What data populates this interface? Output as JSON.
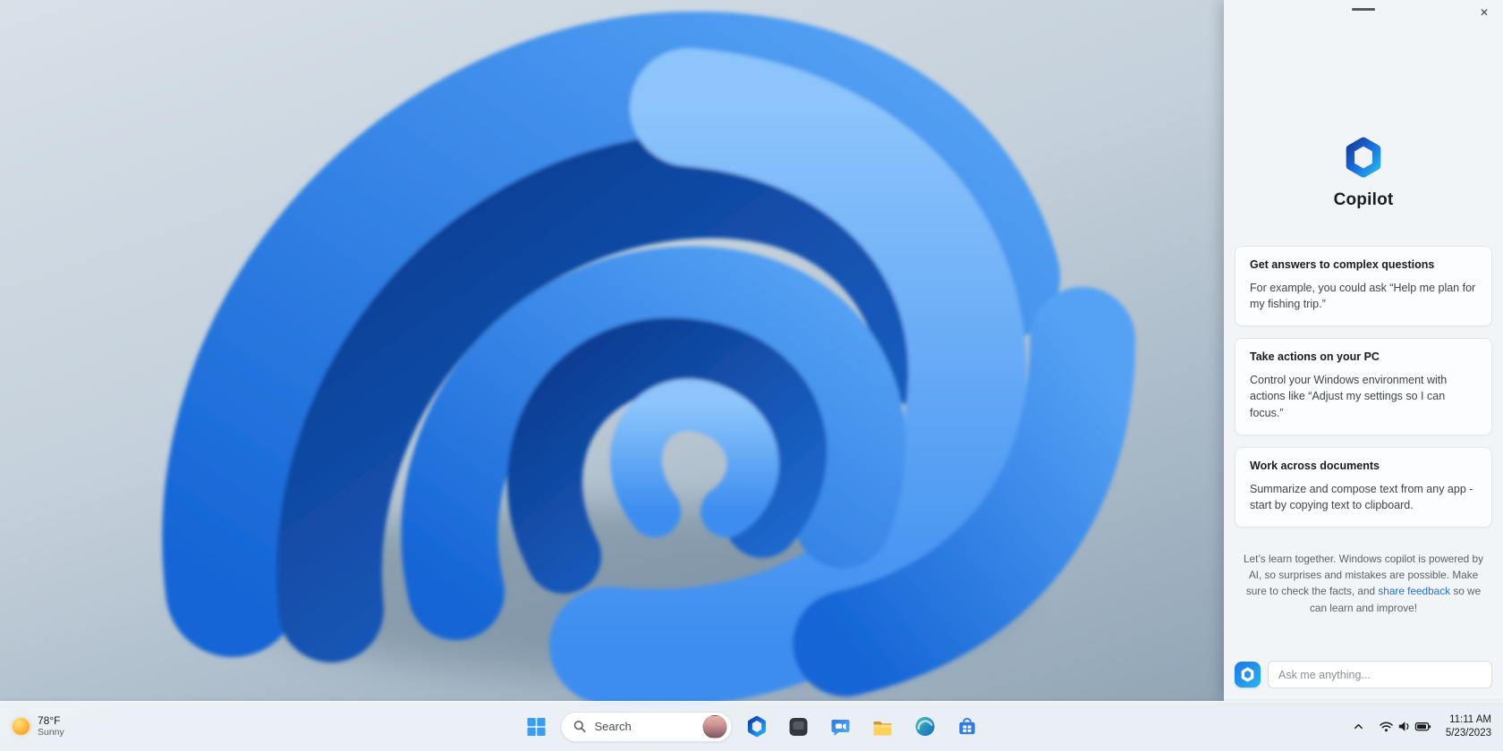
{
  "copilot_panel": {
    "title": "Copilot",
    "window_controls": {
      "close_glyph": "✕"
    },
    "cards": [
      {
        "title": "Get answers to complex questions",
        "body": "For example, you could ask “Help me plan for my fishing trip.”"
      },
      {
        "title": "Take actions on your PC",
        "body": "Control your Windows environment with actions like “Adjust my settings so I can focus.”"
      },
      {
        "title": "Work across documents",
        "body": "Summarize and compose text from any app - start by copying text to clipboard."
      }
    ],
    "disclaimer": {
      "pre": "Let’s learn together. Windows copilot is powered by AI, so surprises and mistakes are possible. Make sure to check the facts, and ",
      "link": "share feedback",
      "post": " so we can learn and improve!"
    },
    "input_placeholder": "Ask me anything..."
  },
  "taskbar": {
    "weather": {
      "temp": "78°F",
      "condition": "Sunny"
    },
    "search": {
      "label": "Search"
    },
    "clock": {
      "time": "11:11 AM",
      "date": "5/23/2023"
    }
  },
  "icons": {
    "copilot_logo": "hexagon-ring-gradient",
    "minimize": "drag-dash",
    "close": "✕",
    "search": "magnifier",
    "chevron_up": "^",
    "network": "wifi-arcs",
    "volume": "speaker",
    "battery": "battery"
  },
  "colors": {
    "accent": "#2470d4",
    "link": "#2470d4",
    "bloom_blue": "#1565d6"
  }
}
